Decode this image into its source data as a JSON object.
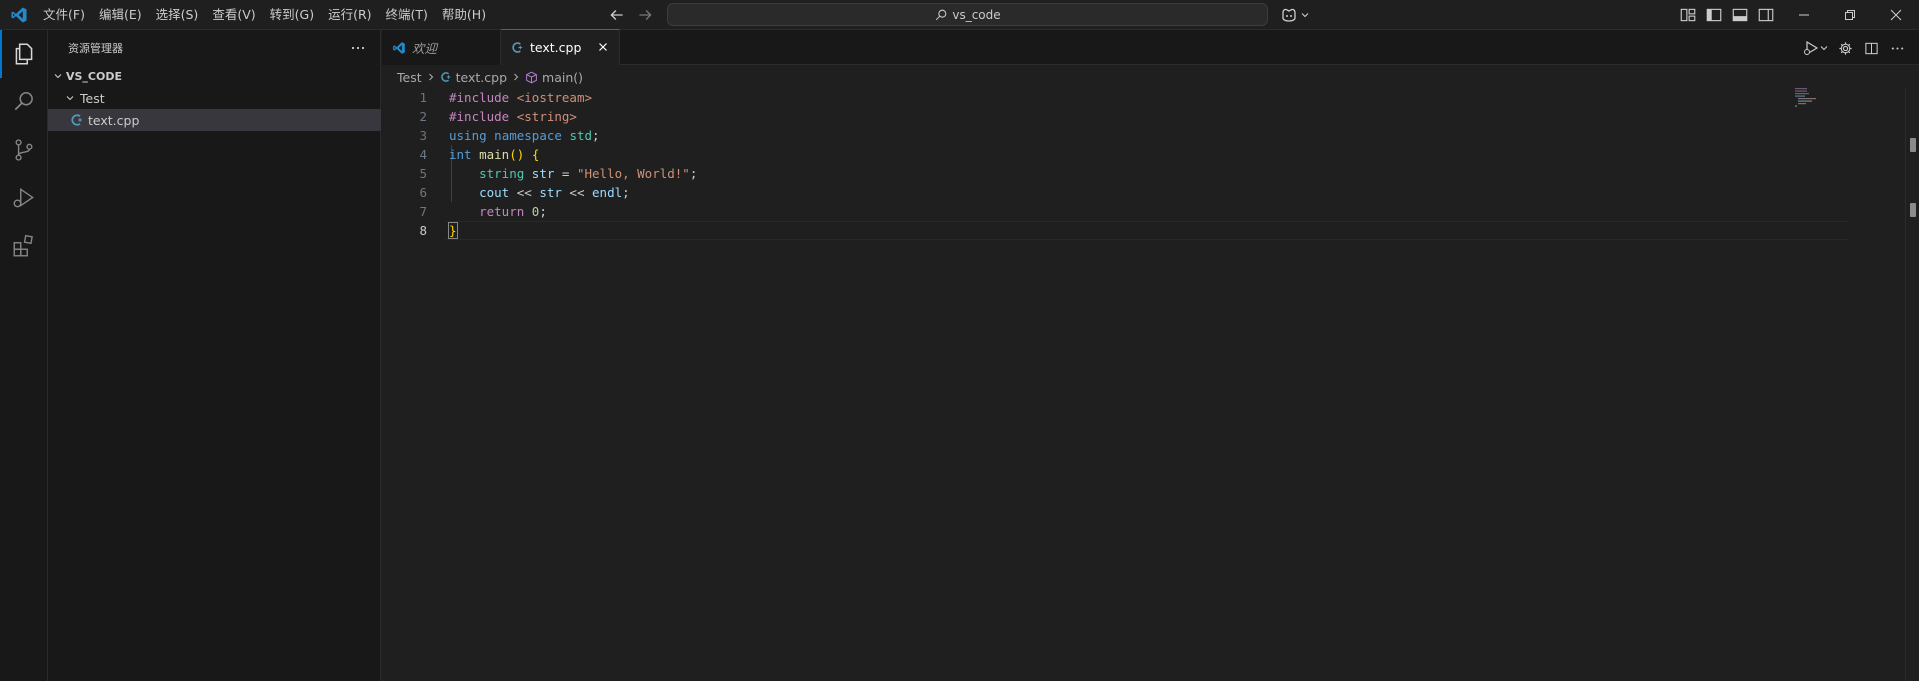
{
  "titlebar": {
    "menu": [
      "文件(F)",
      "编辑(E)",
      "选择(S)",
      "查看(V)",
      "转到(G)",
      "运行(R)",
      "终端(T)",
      "帮助(H)"
    ],
    "search_text": "vs_code"
  },
  "sidebar": {
    "title": "资源管理器",
    "workspace": "VS_CODE",
    "folder": "Test",
    "file": "text.cpp"
  },
  "tabs": [
    {
      "label": "欢迎",
      "active": false
    },
    {
      "label": "text.cpp",
      "active": true
    }
  ],
  "breadcrumb": [
    "Test",
    "text.cpp",
    "main()"
  ],
  "editor": {
    "line_numbers": [
      "1",
      "2",
      "3",
      "4",
      "5",
      "6",
      "7",
      "8"
    ],
    "current_line": "8"
  },
  "colors": {
    "accent": "#0078d4",
    "background": "#1f1f1f",
    "sidebar_bg": "#181818",
    "cpp_icon": "#519aba"
  },
  "icons": {
    "activity": [
      "explorer-icon",
      "search-icon",
      "source-control-icon",
      "run-debug-icon",
      "extensions-icon"
    ],
    "title_right": [
      "customize-layout-icon",
      "toggle-primary-sidebar-icon",
      "toggle-panel-icon",
      "toggle-secondary-sidebar-icon"
    ],
    "editor_actions": [
      "run-icon",
      "settings-gear-icon",
      "split-editor-icon",
      "more-actions-icon"
    ]
  }
}
